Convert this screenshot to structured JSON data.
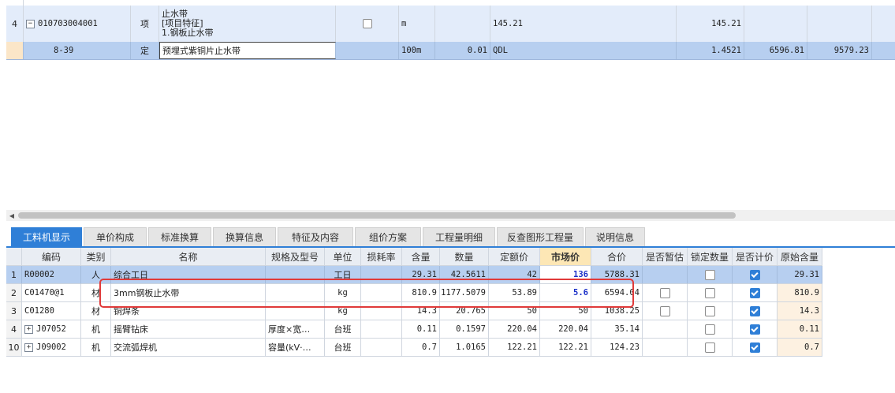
{
  "upper_rows": [
    {
      "index": "4",
      "code": "010703004001",
      "type": "项",
      "name_lines": [
        "止水带",
        "[项目特征]",
        "1.钢板止水带"
      ],
      "unit": "m",
      "quantity": "",
      "expr": "145.21",
      "qty2": "145.21",
      "price": "",
      "total": ""
    },
    {
      "index": "",
      "code": "8-39",
      "type": "定",
      "name": "预埋式紫铜片止水带",
      "unit": "100m",
      "quantity": "0.01",
      "expr": "QDL",
      "qty2": "1.4521",
      "price": "6596.81",
      "total": "9579.23"
    }
  ],
  "tabs": [
    {
      "label": "工料机显示",
      "active": true
    },
    {
      "label": "单价构成",
      "active": false
    },
    {
      "label": "标准换算",
      "active": false
    },
    {
      "label": "换算信息",
      "active": false
    },
    {
      "label": "特征及内容",
      "active": false
    },
    {
      "label": "组价方案",
      "active": false
    },
    {
      "label": "工程量明细",
      "active": false
    },
    {
      "label": "反查图形工程量",
      "active": false
    },
    {
      "label": "说明信息",
      "active": false
    }
  ],
  "table": {
    "headers": [
      "编码",
      "类别",
      "名称",
      "规格及型号",
      "单位",
      "损耗率",
      "含量",
      "数量",
      "定额价",
      "市场价",
      "合价",
      "是否暂估",
      "锁定数量",
      "是否计价",
      "原始含量"
    ],
    "rows": [
      {
        "idx": "1",
        "expand": "",
        "code": "R00002",
        "cat": "人",
        "name": "综合工日",
        "spec": "",
        "unit": "工日",
        "loss": "",
        "content": "29.31",
        "qty": "42.5611",
        "base": "42",
        "market": "136",
        "total": "5788.31",
        "est": null,
        "lock": false,
        "priced": true,
        "orig": "29.31"
      },
      {
        "idx": "2",
        "expand": "",
        "code": "C01470@1",
        "cat": "材",
        "name": "3mm钢板止水带",
        "spec": "",
        "unit": "kg",
        "loss": "",
        "content": "810.9",
        "qty": "1177.5079",
        "base": "53.89",
        "market": "5.6",
        "total": "6594.04",
        "est": false,
        "lock": false,
        "priced": true,
        "orig": "810.9"
      },
      {
        "idx": "3",
        "expand": "",
        "code": "C01280",
        "cat": "材",
        "name": "铜焊条",
        "spec": "",
        "unit": "kg",
        "loss": "",
        "content": "14.3",
        "qty": "20.765",
        "base": "50",
        "market": "50",
        "total": "1038.25",
        "est": false,
        "lock": false,
        "priced": true,
        "orig": "14.3"
      },
      {
        "idx": "4",
        "expand": "+",
        "code": "J07052",
        "cat": "机",
        "name": "摇臂钻床",
        "spec": "厚度×宽…",
        "unit": "台班",
        "loss": "",
        "content": "0.11",
        "qty": "0.1597",
        "base": "220.04",
        "market": "220.04",
        "total": "35.14",
        "est": null,
        "lock": false,
        "priced": true,
        "orig": "0.11"
      },
      {
        "idx": "10",
        "expand": "+",
        "code": "J09002",
        "cat": "机",
        "name": "交流弧焊机",
        "spec": "容量(kV·…",
        "unit": "台班",
        "loss": "",
        "content": "0.7",
        "qty": "1.0165",
        "base": "122.21",
        "market": "122.21",
        "total": "124.23",
        "est": null,
        "lock": false,
        "priced": true,
        "orig": "0.7"
      }
    ]
  },
  "colors": {
    "accent": "#2f7fd7",
    "selected_row": "#b7cff0",
    "highlight_header": "#fde7b5",
    "annotation": "#e03a3a"
  }
}
